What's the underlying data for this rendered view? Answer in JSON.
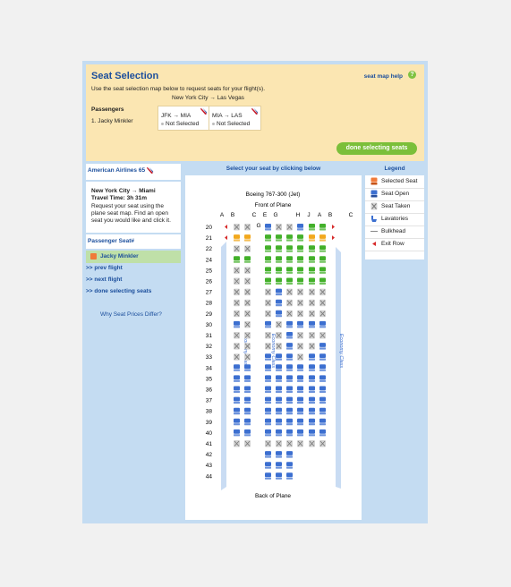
{
  "header": {
    "title": "Seat Selection",
    "help": "seat map help",
    "help_icon": "?",
    "instructions": "Use the seat selection map below to request seats for your flight(s).",
    "route": "New York City → Las Vegas",
    "passengers_heading": "Passengers",
    "passenger": "1. Jacky Minkler",
    "segments": [
      {
        "route": "JFK → MIA",
        "status": "Not Selected"
      },
      {
        "route": "MIA → LAS",
        "status": "Not Selected"
      }
    ],
    "done_button": "done selecting seats"
  },
  "left": {
    "flight_label": "American Airlines 65",
    "flight_title": "New York City → Miami",
    "travel_time": "Travel Time: 3h 31m",
    "description": "Request your seat using the plane seat map. Find an open seat you would like and click it.",
    "passenger_seat_heading": "Passenger Seat#",
    "selected_passenger": "Jacky Minkler",
    "prev": ">> prev flight",
    "next": ">> next flight",
    "done": ">> done selecting seats",
    "why": "Why Seat Prices Differ?"
  },
  "center": {
    "heading": "Select your seat by clicking below",
    "aircraft": "Boeing 767-300 (Jet)",
    "front": "Front of Plane",
    "back": "Back of Plane",
    "cabin_label": "Economy Class",
    "column_letters": [
      "A",
      "B",
      "C",
      "E",
      "G",
      "H",
      "J",
      "A",
      "B",
      "C"
    ],
    "galley_label": "G"
  },
  "legend": {
    "heading": "Legend",
    "items": [
      {
        "label": "Selected Seat",
        "icon": "selected-seat-icon"
      },
      {
        "label": "Seat Open",
        "icon": "open-seat-icon"
      },
      {
        "label": "Seat Taken",
        "icon": "taken-seat-icon"
      },
      {
        "label": "Lavatories",
        "icon": "lavatory-icon"
      },
      {
        "label": "Bulkhead",
        "icon": "bulkhead-icon"
      },
      {
        "label": "Exit Row",
        "icon": "exit-row-icon"
      }
    ]
  },
  "colors": {
    "open": "#3c6fd0",
    "open_preferred": "#43b02a",
    "exit_premium": "#f2a81d",
    "taken": "#c4c4c4",
    "selected": "#f07a3a",
    "link": "#1b4e9c"
  },
  "seatmap": {
    "rows": [
      {
        "row": "20",
        "exit": true,
        "left": "xx",
        "mid": "oxxo",
        "right": "ee"
      },
      {
        "row": "21",
        "exit": true,
        "left": "pp",
        "mid": "eeee",
        "right": "pp"
      },
      {
        "row": "22",
        "exit": false,
        "left": "xx",
        "mid": "eeee",
        "right": "ee"
      },
      {
        "row": "24",
        "exit": false,
        "left": "ee",
        "mid": "eeee",
        "right": "ee"
      },
      {
        "row": "25",
        "exit": false,
        "left": "xx",
        "mid": "eeee",
        "right": "ee"
      },
      {
        "row": "26",
        "exit": false,
        "left": "xx",
        "mid": "eeee",
        "right": "ee"
      },
      {
        "row": "27",
        "exit": false,
        "left": "xx",
        "mid": "xoxx",
        "right": "xx"
      },
      {
        "row": "28",
        "exit": false,
        "left": "xx",
        "mid": "xoxx",
        "right": "xx"
      },
      {
        "row": "29",
        "exit": false,
        "left": "xx",
        "mid": "xoxx",
        "right": "xx"
      },
      {
        "row": "30",
        "exit": false,
        "left": "ox",
        "mid": "oxoo",
        "right": "oo"
      },
      {
        "row": "31",
        "exit": false,
        "left": "xx",
        "mid": "xxox",
        "right": "xx"
      },
      {
        "row": "32",
        "exit": false,
        "left": "xx",
        "mid": "xxox",
        "right": "xo"
      },
      {
        "row": "33",
        "exit": false,
        "left": "xx",
        "mid": "ooox",
        "right": "oo"
      },
      {
        "row": "34",
        "exit": false,
        "left": "oo",
        "mid": "oooo",
        "right": "oo"
      },
      {
        "row": "35",
        "exit": false,
        "left": "oo",
        "mid": "oooo",
        "right": "oo"
      },
      {
        "row": "36",
        "exit": false,
        "left": "oo",
        "mid": "oooo",
        "right": "oo"
      },
      {
        "row": "37",
        "exit": false,
        "left": "oo",
        "mid": "oooo",
        "right": "oo"
      },
      {
        "row": "38",
        "exit": false,
        "left": "oo",
        "mid": "oooo",
        "right": "oo"
      },
      {
        "row": "39",
        "exit": false,
        "left": "oo",
        "mid": "oooo",
        "right": "oo"
      },
      {
        "row": "40",
        "exit": false,
        "left": "oo",
        "mid": "oooo",
        "right": "oo"
      },
      {
        "row": "41",
        "exit": false,
        "left": "xx",
        "mid": "xxxx",
        "right": "xx"
      },
      {
        "row": "42",
        "exit": false,
        "left": "",
        "mid": "ooo",
        "right": ""
      },
      {
        "row": "43",
        "exit": false,
        "left": "",
        "mid": "ooo",
        "right": ""
      },
      {
        "row": "44",
        "exit": false,
        "left": "",
        "mid": "ooo",
        "right": ""
      }
    ]
  }
}
